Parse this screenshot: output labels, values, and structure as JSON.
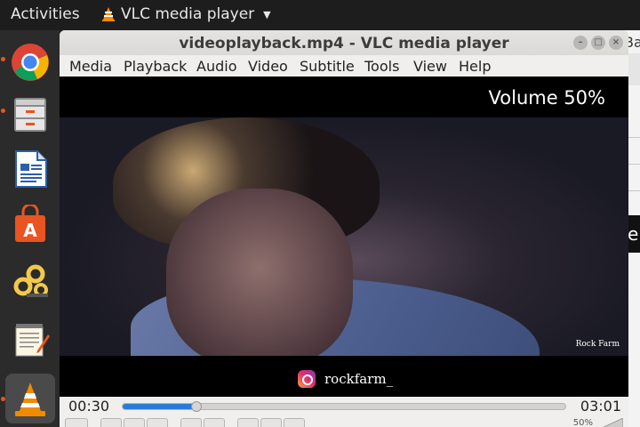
{
  "topbar": {
    "activities": "Activities",
    "app_name": "VLC media player"
  },
  "dock": {
    "items": [
      {
        "icon": "chrome-icon",
        "running": true
      },
      {
        "icon": "file-cabinet-icon",
        "running": true
      },
      {
        "icon": "writer-document-icon",
        "running": false
      },
      {
        "icon": "software-center-icon",
        "running": false
      },
      {
        "icon": "network-gears-icon",
        "running": false
      },
      {
        "icon": "text-editor-icon",
        "running": false
      },
      {
        "icon": "vlc-cone-icon",
        "running": true
      }
    ]
  },
  "window": {
    "title": "videoplayback.mp4 - VLC media player",
    "controls": [
      "minimize",
      "maximize",
      "close"
    ]
  },
  "menu": {
    "items": [
      "Media",
      "Playback",
      "Audio",
      "Video",
      "Subtitle",
      "Tools",
      "View",
      "Help"
    ]
  },
  "video": {
    "osd": "Volume 50%",
    "social_handle": "rockfarm_",
    "watermark": "Rock Farm"
  },
  "controls": {
    "current_time": "00:30",
    "total_time": "03:01",
    "progress": 0.166,
    "volume_label": "50%"
  },
  "background": {
    "partial_text_1": "Ba",
    "partial_text_2": "e"
  },
  "colors": {
    "accent": "#2b7bd6",
    "ubuntu_orange": "#e95420"
  }
}
